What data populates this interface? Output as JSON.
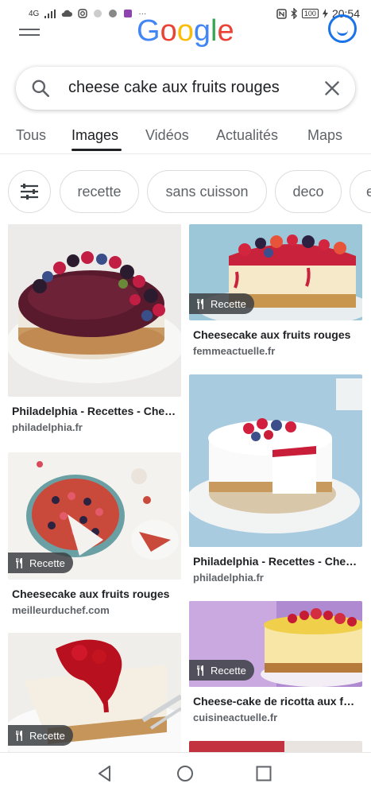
{
  "status_bar": {
    "network": "4G",
    "time": "20:54",
    "battery": "100"
  },
  "header": {
    "logo_text": "Google",
    "logo_colors": [
      "#4285F4",
      "#EA4335",
      "#FBBC05",
      "#4285F4",
      "#34A853",
      "#EA4335"
    ]
  },
  "search": {
    "query": "cheese cake aux fruits rouges"
  },
  "tabs": [
    {
      "label": "Tous"
    },
    {
      "label": "Images"
    },
    {
      "label": "Vidéos"
    },
    {
      "label": "Actualités"
    },
    {
      "label": "Maps"
    }
  ],
  "chips": [
    {
      "label": "recette"
    },
    {
      "label": "sans cuisson"
    },
    {
      "label": "deco"
    },
    {
      "label": "e"
    }
  ],
  "results": [
    {
      "title": "Philadelphia - Recettes - Cheesecake aux fruits rouges",
      "site": "philadelphia.fr",
      "badge": ""
    },
    {
      "title": "Cheesecake aux fruits rouges",
      "site": "femmeactuelle.fr",
      "badge": "Recette"
    },
    {
      "title": "Philadelphia - Recettes - Cheesecake",
      "site": "philadelphia.fr",
      "badge": ""
    },
    {
      "title": "Cheesecake aux fruits rouges",
      "site": "meilleurduchef.com",
      "badge": "Recette"
    },
    {
      "title": "Cheese-cake de ricotta aux fruits rouges",
      "site": "cuisineactuelle.fr",
      "badge": "Recette"
    },
    {
      "title": "",
      "site": "",
      "badge": "Recette"
    }
  ],
  "colors": {
    "accent": "#1a73e8",
    "badge_bg": "#3c4043"
  }
}
